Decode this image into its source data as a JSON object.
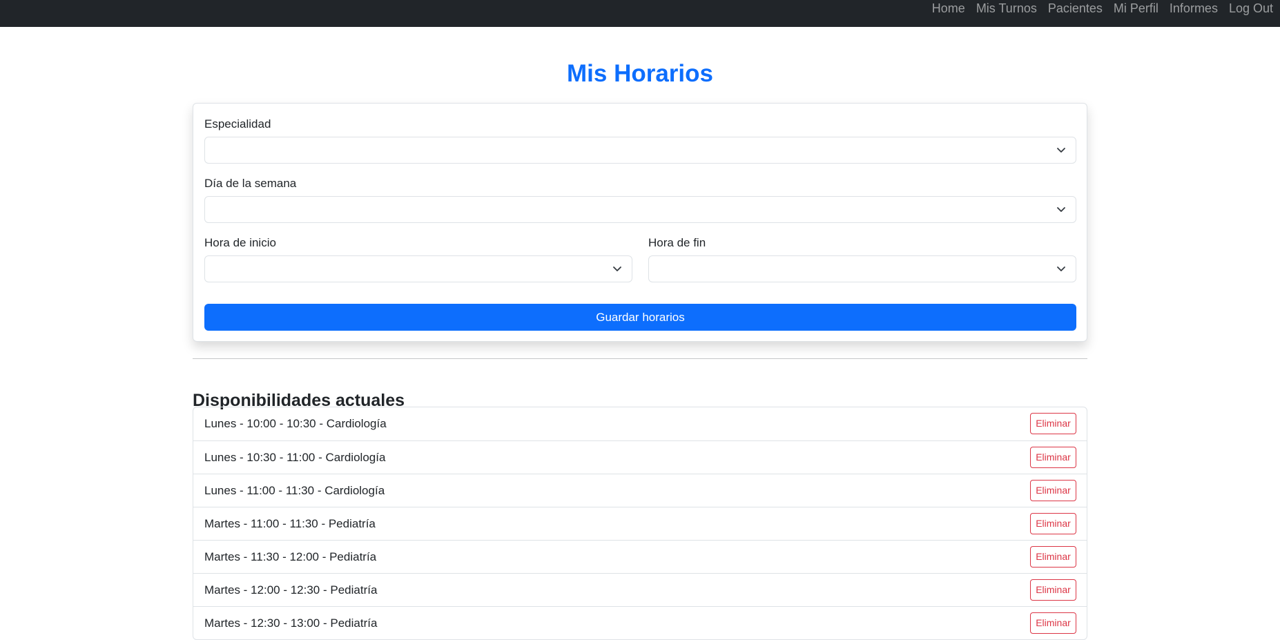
{
  "nav": {
    "items": [
      {
        "label": "Home"
      },
      {
        "label": "Mis Turnos"
      },
      {
        "label": "Pacientes"
      },
      {
        "label": "Mi Perfil"
      },
      {
        "label": "Informes"
      },
      {
        "label": "Log Out"
      }
    ]
  },
  "page": {
    "title": "Mis Horarios"
  },
  "form": {
    "especialidad_label": "Especialidad",
    "especialidad_value": "",
    "dia_label": "Día de la semana",
    "dia_value": "",
    "hora_inicio_label": "Hora de inicio",
    "hora_inicio_value": "",
    "hora_fin_label": "Hora de fin",
    "hora_fin_value": "",
    "save_label": "Guardar horarios"
  },
  "availability": {
    "title": "Disponibilidades actuales",
    "delete_label": "Eliminar",
    "items": [
      {
        "text": "Lunes - 10:00 - 10:30 - Cardiología"
      },
      {
        "text": "Lunes - 10:30 - 11:00 - Cardiología"
      },
      {
        "text": "Lunes - 11:00 - 11:30 - Cardiología"
      },
      {
        "text": "Martes - 11:00 - 11:30 - Pediatría"
      },
      {
        "text": "Martes - 11:30 - 12:00 - Pediatría"
      },
      {
        "text": "Martes - 12:00 - 12:30 - Pediatría"
      },
      {
        "text": "Martes - 12:30 - 13:00 - Pediatría"
      }
    ]
  },
  "colors": {
    "navbar_bg": "#212529",
    "primary": "#0d6efd",
    "danger": "#dc3545"
  }
}
